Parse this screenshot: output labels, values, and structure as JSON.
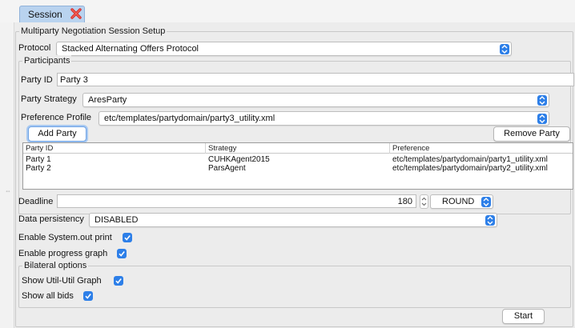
{
  "tab": {
    "label": "Session"
  },
  "setup": {
    "title": "Multiparty Negotiation Session Setup"
  },
  "protocol": {
    "label": "Protocol",
    "value": "Stacked Alternating Offers Protocol"
  },
  "participants": {
    "title": "Participants",
    "party_id_label": "Party ID",
    "party_id_value": "Party 3",
    "strategy_label": "Party Strategy",
    "strategy_value": "AresParty",
    "profile_label": "Preference Profile",
    "profile_value": "etc/templates/partydomain/party3_utility.xml",
    "add_button": "Add Party",
    "remove_button": "Remove Party",
    "table": {
      "headers": [
        "Party ID",
        "Strategy",
        "Preference"
      ],
      "rows": [
        [
          "Party 1",
          "CUHKAgent2015",
          "etc/templates/partydomain/party1_utility.xml"
        ],
        [
          "Party 2",
          "ParsAgent",
          "etc/templates/partydomain/party2_utility.xml"
        ]
      ]
    }
  },
  "deadline": {
    "label": "Deadline",
    "value": "180",
    "unit": "ROUND"
  },
  "persistency": {
    "label": "Data persistency",
    "value": "DISABLED"
  },
  "options": {
    "system_out_label": "Enable System.out print",
    "system_out_checked": true,
    "progress_label": "Enable progress graph",
    "progress_checked": true
  },
  "bilateral": {
    "title": "Bilateral options",
    "util_graph_label": "Show Util-Util Graph",
    "util_graph_checked": true,
    "all_bids_label": "Show all bids",
    "all_bids_checked": true
  },
  "start_button": "Start",
  "colors": {
    "accent": "#2d7fe8",
    "tab": "#b9d3ef",
    "close": "#d9302c",
    "panel": "#ececec"
  },
  "icons": {
    "close": "close-icon",
    "updown": "chevron-updown-icon",
    "check": "checkmark-icon"
  }
}
